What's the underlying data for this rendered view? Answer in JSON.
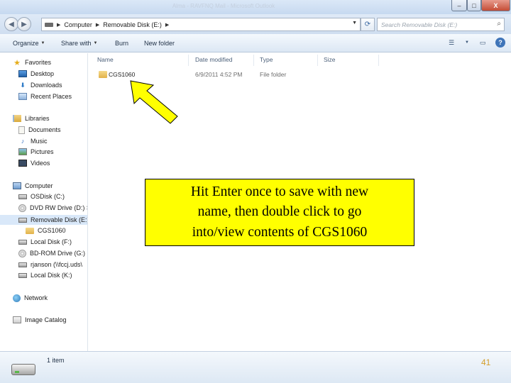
{
  "window": {
    "title": "Alma - RAVFNQ Mail - Microsoft Outlook",
    "controls": {
      "minimize": "–",
      "maximize": "□",
      "close": "X"
    }
  },
  "address": {
    "segments": [
      "Computer",
      "Removable Disk (E:)"
    ],
    "search_placeholder": "Search Removable Disk (E:)"
  },
  "toolbar": {
    "organize": "Organize",
    "share_with": "Share with",
    "burn": "Burn",
    "new_folder": "New folder"
  },
  "nav": {
    "favorites": {
      "header": "Favorites",
      "items": [
        "Desktop",
        "Downloads",
        "Recent Places"
      ]
    },
    "libraries": {
      "header": "Libraries",
      "items": [
        "Documents",
        "Music",
        "Pictures",
        "Videos"
      ]
    },
    "computer": {
      "header": "Computer",
      "items": [
        "OSDisk (C:)",
        "DVD RW Drive (D:) S",
        "Removable Disk (E:)",
        "CGS1060",
        "Local Disk (F:)",
        "BD-ROM Drive (G:) (",
        "rjanson (\\\\fccj.uds\\",
        "Local Disk (K:)"
      ]
    },
    "network": "Network",
    "image_catalog": "Image Catalog"
  },
  "columns": {
    "name": "Name",
    "date_modified": "Date modified",
    "type": "Type",
    "size": "Size"
  },
  "files": [
    {
      "name": "CGS1060",
      "date_modified": "6/9/2011 4:52 PM",
      "type": "File folder",
      "size": ""
    }
  ],
  "annotation": {
    "line1": "Hit Enter once to save with new",
    "line2": "name, then double click to go",
    "line3": "into/view contents of CGS1060"
  },
  "details": {
    "count": "1 item"
  },
  "slide": {
    "page": "41"
  },
  "colors": {
    "callout": "#ffff00",
    "arrow": "#ffff00",
    "selection": "#d9e8f9",
    "page_number": "#d39e2b"
  }
}
